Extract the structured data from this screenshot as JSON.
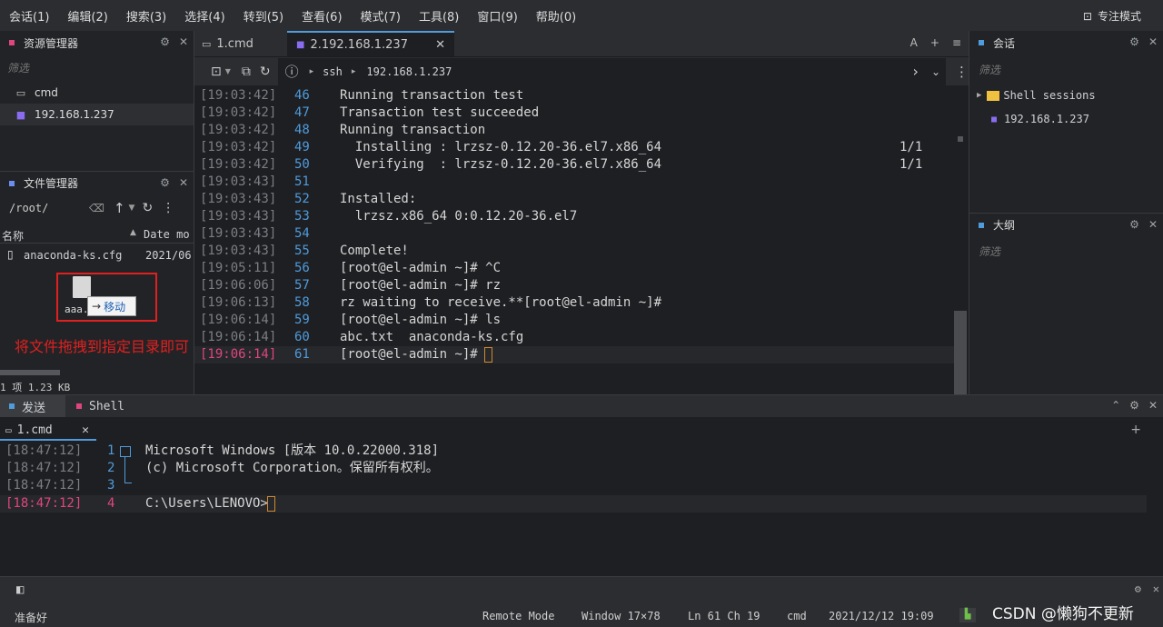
{
  "menu": [
    "会话(1)",
    "编辑(2)",
    "搜索(3)",
    "选择(4)",
    "转到(5)",
    "查看(6)",
    "模式(7)",
    "工具(8)",
    "窗口(9)",
    "帮助(0)"
  ],
  "focus_mode": "专注模式",
  "resource_manager": {
    "title": "资源管理器",
    "filter_placeholder": "筛选",
    "items": [
      {
        "label": "cmd",
        "icon": "terminal-icon"
      },
      {
        "label": "192.168.1.237",
        "icon": "ssh-square-icon"
      }
    ]
  },
  "file_manager": {
    "title": "文件管理器",
    "path": "/root/",
    "col_name": "名称",
    "col_date": "Date mo",
    "files": [
      {
        "name": "anaconda-ks.cfg",
        "date": "2021/06"
      }
    ],
    "drag_file": "aaa.",
    "drag_tip": "移动",
    "annotation": "将文件拖拽到指定目录即可",
    "footer": "1 项 1.23 KB"
  },
  "tabs": [
    {
      "label": "1.cmd"
    },
    {
      "label": "2.192.168.1.237"
    }
  ],
  "tab_tools": [
    "A",
    "+",
    "≡"
  ],
  "toolbar": {
    "proto": "ssh",
    "host": "192.168.1.237"
  },
  "terminal": {
    "lines": [
      {
        "ts": "[19:03:42]",
        "n": "46",
        "text": "Running transaction test",
        "right": ""
      },
      {
        "ts": "[19:03:42]",
        "n": "47",
        "text": "Transaction test succeeded",
        "right": ""
      },
      {
        "ts": "[19:03:42]",
        "n": "48",
        "text": "Running transaction",
        "right": ""
      },
      {
        "ts": "[19:03:42]",
        "n": "49",
        "text": "  Installing : lrzsz-0.12.20-36.el7.x86_64",
        "right": "1/1"
      },
      {
        "ts": "[19:03:42]",
        "n": "50",
        "text": "  Verifying  : lrzsz-0.12.20-36.el7.x86_64",
        "right": "1/1"
      },
      {
        "ts": "[19:03:43]",
        "n": "51",
        "text": "",
        "right": ""
      },
      {
        "ts": "[19:03:43]",
        "n": "52",
        "text": "Installed:",
        "right": ""
      },
      {
        "ts": "[19:03:43]",
        "n": "53",
        "text": "  lrzsz.x86_64 0:0.12.20-36.el7",
        "right": ""
      },
      {
        "ts": "[19:03:43]",
        "n": "54",
        "text": "",
        "right": ""
      },
      {
        "ts": "[19:03:43]",
        "n": "55",
        "text": "Complete!",
        "right": ""
      },
      {
        "ts": "[19:05:11]",
        "n": "56",
        "text": "[root@el-admin ~]# ^C",
        "right": ""
      },
      {
        "ts": "[19:06:06]",
        "n": "57",
        "text": "[root@el-admin ~]# rz",
        "right": ""
      },
      {
        "ts": "[19:06:13]",
        "n": "58",
        "text": "rz waiting to receive.**[root@el-admin ~]#",
        "right": ""
      },
      {
        "ts": "[19:06:14]",
        "n": "59",
        "text": "[root@el-admin ~]# ls",
        "right": ""
      },
      {
        "ts": "[19:06:14]",
        "n": "60",
        "text": "abc.txt  anaconda-ks.cfg",
        "right": ""
      },
      {
        "ts": "[19:06:14]",
        "n": "61",
        "text": "[root@el-admin ~]# ",
        "right": ""
      }
    ]
  },
  "sessions_panel": {
    "title": "会话",
    "filter_placeholder": "筛选",
    "folder": "Shell sessions",
    "item": "192.168.1.237"
  },
  "outline_panel": {
    "title": "大纲",
    "filter_placeholder": "筛选"
  },
  "bottom": {
    "tabs": [
      "发送",
      "Shell"
    ],
    "subtab": "1.cmd",
    "lines": [
      {
        "ts": "[18:47:12]",
        "n": "1",
        "text": "Microsoft Windows [版本 10.0.22000.318]"
      },
      {
        "ts": "[18:47:12]",
        "n": "2",
        "text": "(c) Microsoft Corporation。保留所有权利。"
      },
      {
        "ts": "[18:47:12]",
        "n": "3",
        "text": ""
      },
      {
        "ts": "[18:47:12]",
        "n": "4",
        "text": "C:\\Users\\LENOVO>"
      }
    ]
  },
  "status": {
    "ready": "准备好",
    "mode": "Remote Mode",
    "window": "Window 17×78",
    "pos": "Ln 61 Ch 19",
    "shell": "cmd",
    "time": "2021/12/12 19:09",
    "watermark": "CSDN @懒狗不更新"
  },
  "colors": {
    "accent": "#4f9bdc",
    "active_ts": "#e0467c",
    "cursor": "#d08a2c",
    "red_box": "#e02020"
  }
}
